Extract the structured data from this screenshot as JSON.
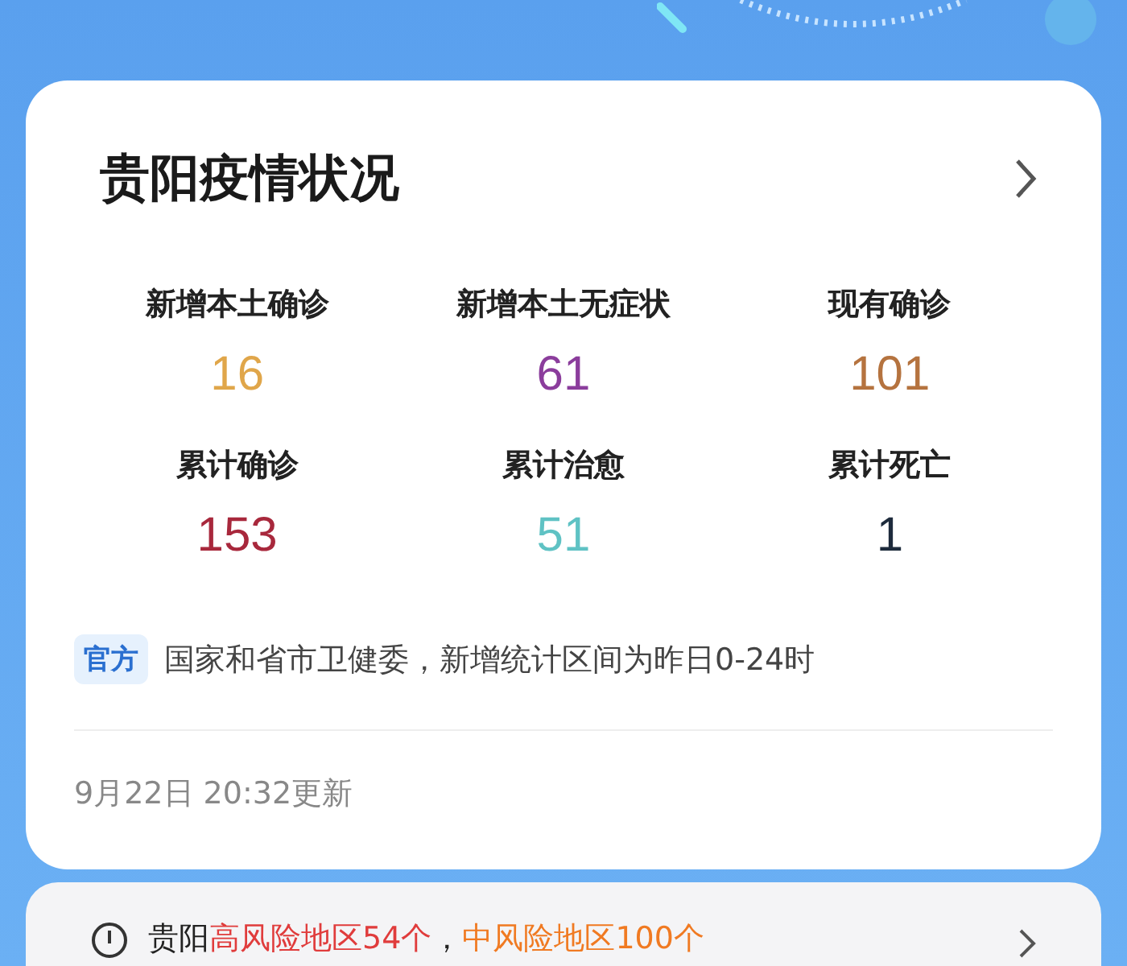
{
  "card": {
    "title": "贵阳疫情状况",
    "stats": [
      {
        "label": "新增本土确诊",
        "value": "16",
        "color": "#e0a64a"
      },
      {
        "label": "新增本土无症状",
        "value": "61",
        "color": "#8b3d9c"
      },
      {
        "label": "现有确诊",
        "value": "101",
        "color": "#b5733f"
      },
      {
        "label": "累计确诊",
        "value": "153",
        "color": "#a8283c"
      },
      {
        "label": "累计治愈",
        "value": "51",
        "color": "#5fc2c4"
      },
      {
        "label": "累计死亡",
        "value": "1",
        "color": "#1e2b3c"
      }
    ],
    "source_tag": "官方",
    "source_text": "国家和省市卫健委，新增统计区间为昨日0-24时",
    "updated": "9月22日 20:32更新"
  },
  "risk_bar": {
    "segments": [
      {
        "kind": "plain",
        "text": "贵阳"
      },
      {
        "kind": "high",
        "text": "高风险地区54个"
      },
      {
        "kind": "plain",
        "text": "，"
      },
      {
        "kind": "medium",
        "text": "中风险地区100个"
      }
    ]
  }
}
